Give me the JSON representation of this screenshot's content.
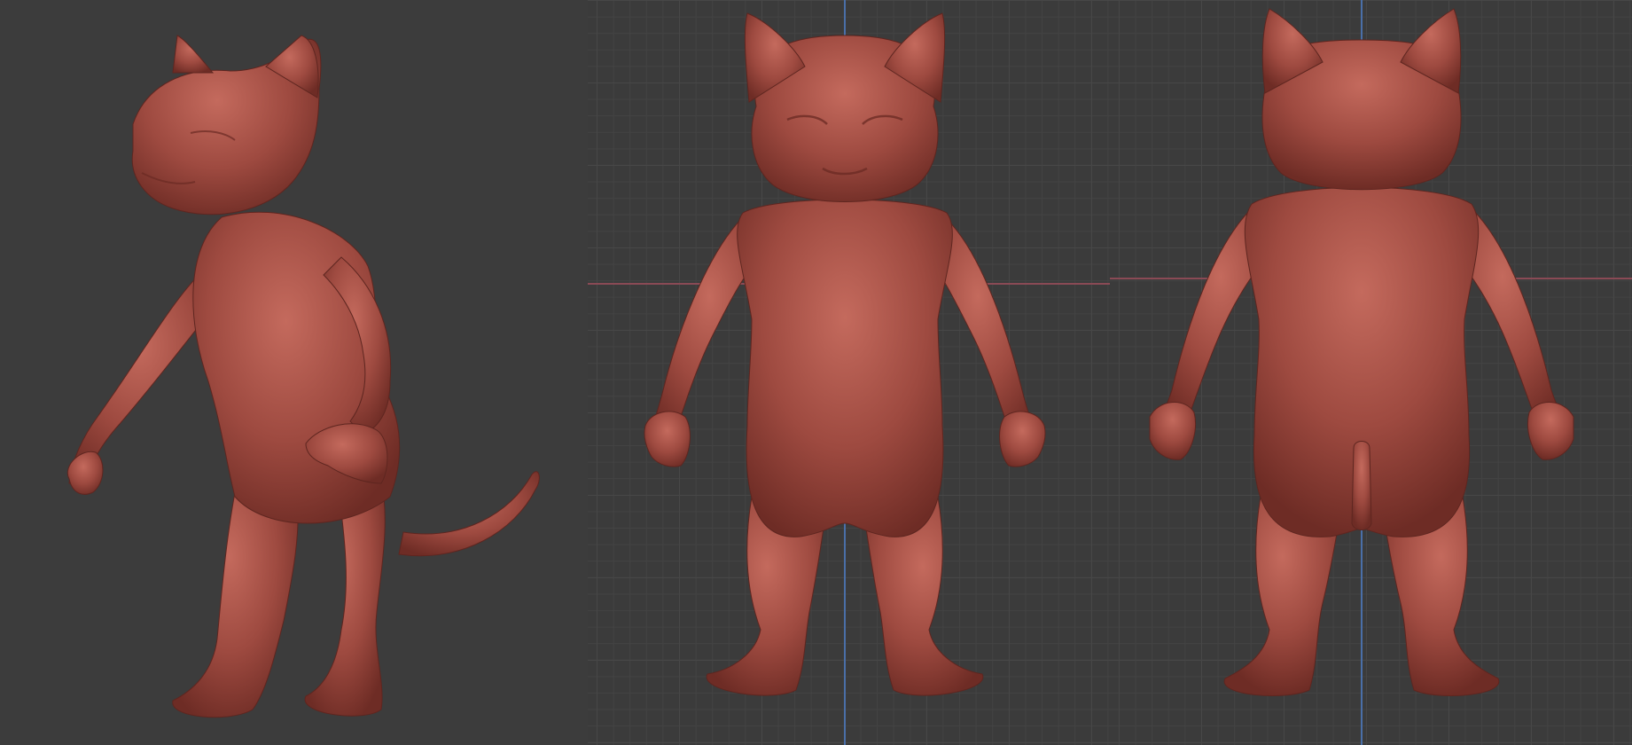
{
  "viewports": [
    {
      "id": "perspective",
      "view": "three-quarter",
      "grid": false,
      "model": "cat-sculpt"
    },
    {
      "id": "front",
      "view": "front-orthographic",
      "grid": true,
      "model": "cat-sculpt"
    },
    {
      "id": "back",
      "view": "back-orthographic",
      "grid": true,
      "model": "cat-sculpt"
    }
  ],
  "colors": {
    "background": "#3c3c3c",
    "grid_line": "#474747",
    "x_axis": "#8a4a55",
    "z_axis": "#4a6fa8",
    "clay": "#9e4a40",
    "clay_highlight": "#c0675b",
    "clay_shadow": "#6e2c25"
  }
}
